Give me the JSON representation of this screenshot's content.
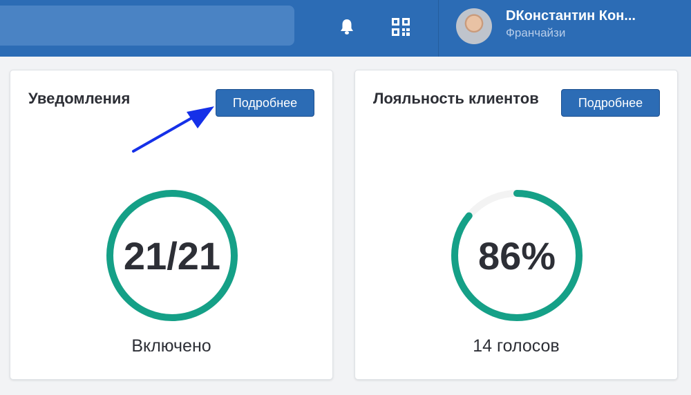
{
  "header": {
    "search_placeholder": "",
    "icons": [
      "bell-icon",
      "qr-code-icon"
    ],
    "user": {
      "name": "DКонстантин Кон...",
      "role": "Франчайзи"
    }
  },
  "cards": [
    {
      "title": "Уведомления",
      "button_label": "Подробнее",
      "value_text": "21/21",
      "progress_fraction": 1.0,
      "caption": "Включено"
    },
    {
      "title": "Лояльность клиентов",
      "button_label": "Подробнее",
      "value_text": "86%",
      "progress_fraction": 0.86,
      "caption": "14 голосов"
    }
  ],
  "colors": {
    "header_bg": "#2c6cb5",
    "ring_fill": "#15a087",
    "ring_track": "#f3f3f3",
    "annotation_arrow": "#1530e8"
  }
}
